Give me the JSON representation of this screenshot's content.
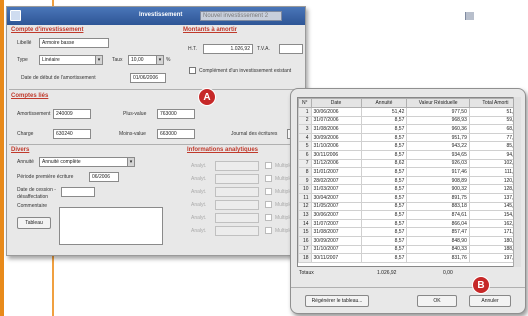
{
  "window": {
    "investissement_label": "Investissement",
    "investissement_value": "Nouvel investissement 2"
  },
  "compte": {
    "title": "Compte d'investissement",
    "libelle_label": "Libellé",
    "libelle_value": "Armoire basse",
    "type_label": "Type",
    "type_value": "Linéaire",
    "taux_label": "Taux",
    "taux_value": "10,00",
    "date_label": "Date de début de l'amortissement",
    "date_value": "01/06/2006"
  },
  "montants": {
    "title": "Montants à amortir",
    "ht_label": "H.T.",
    "ht_value": "1.026,92",
    "tva_label": "T.V.A.",
    "tva_value": "",
    "complement_label": "Complément d'un investissement existant"
  },
  "comptes_lies": {
    "title": "Comptes liés",
    "amortissement_label": "Amortissement",
    "amortissement_value": "240009",
    "plus_value_label": "Plus-value",
    "plus_value_value": "763000",
    "charge_label": "Charge",
    "charge_value": "630240",
    "moins_value_label": "Moins-value",
    "moins_value_value": "663000",
    "journal_label": "Journal des écritures",
    "journal_value": "PA"
  },
  "divers": {
    "title": "Divers",
    "annuite_label": "Annuité",
    "annuite_value": "Annuité complète",
    "periode_label": "Période première écriture",
    "periode_value": "06/2006",
    "cession_label": "Date de cession - désaffectation",
    "cession_value": "",
    "commentaire_label": "Commentaire",
    "tableau_label": "Tableau"
  },
  "analytiques": {
    "title": "Informations analytiques",
    "rows": [
      {
        "label": "Analyt.",
        "value": "Multiple"
      },
      {
        "label": "Analyt.",
        "value": "Multiple"
      },
      {
        "label": "Analyt.",
        "value": "Multiple"
      },
      {
        "label": "Analyt.",
        "value": "Multiple"
      },
      {
        "label": "Analyt.",
        "value": "Multiple"
      },
      {
        "label": "Analyt.",
        "value": "Multiple"
      }
    ]
  },
  "badges": {
    "a": "A",
    "b": "B"
  },
  "schedule": {
    "headers": [
      "N°",
      "Date",
      "Annuité",
      "Valeur Résiduelle",
      "Total Amorti"
    ],
    "rows": [
      [
        "1",
        "30/06/2006",
        "51,42",
        "977,50",
        "51,42"
      ],
      [
        "2",
        "31/07/2006",
        "8,57",
        "968,93",
        "59,99"
      ],
      [
        "3",
        "31/08/2006",
        "8,57",
        "960,36",
        "68,56"
      ],
      [
        "4",
        "30/09/2006",
        "8,57",
        "951,79",
        "77,13"
      ],
      [
        "5",
        "31/10/2006",
        "8,57",
        "943,22",
        "85,70"
      ],
      [
        "6",
        "30/11/2006",
        "8,57",
        "934,65",
        "94,27"
      ],
      [
        "7",
        "31/12/2006",
        "8,62",
        "926,03",
        "102,89"
      ],
      [
        "8",
        "31/01/2007",
        "8,57",
        "917,46",
        "111,46"
      ],
      [
        "9",
        "28/02/2007",
        "8,57",
        "908,89",
        "120,03"
      ],
      [
        "10",
        "31/03/2007",
        "8,57",
        "900,32",
        "128,60"
      ],
      [
        "11",
        "30/04/2007",
        "8,57",
        "891,75",
        "137,17"
      ],
      [
        "12",
        "31/05/2007",
        "8,57",
        "883,18",
        "145,74"
      ],
      [
        "13",
        "30/06/2007",
        "8,57",
        "874,61",
        "154,31"
      ],
      [
        "14",
        "31/07/2007",
        "8,57",
        "866,04",
        "162,88"
      ],
      [
        "15",
        "31/08/2007",
        "8,57",
        "857,47",
        "171,45"
      ],
      [
        "16",
        "30/09/2007",
        "8,57",
        "848,90",
        "180,02"
      ],
      [
        "17",
        "31/10/2007",
        "8,57",
        "840,33",
        "188,59"
      ],
      [
        "18",
        "30/11/2007",
        "8,57",
        "831,76",
        "197,16"
      ]
    ],
    "totals_label": "Totaux",
    "totals_annuite": "1.026,92",
    "totals_valeur": "0,00",
    "regen_label": "Régénérer le tableau...",
    "ok_label": "OK",
    "cancel_label": "Annuler"
  }
}
